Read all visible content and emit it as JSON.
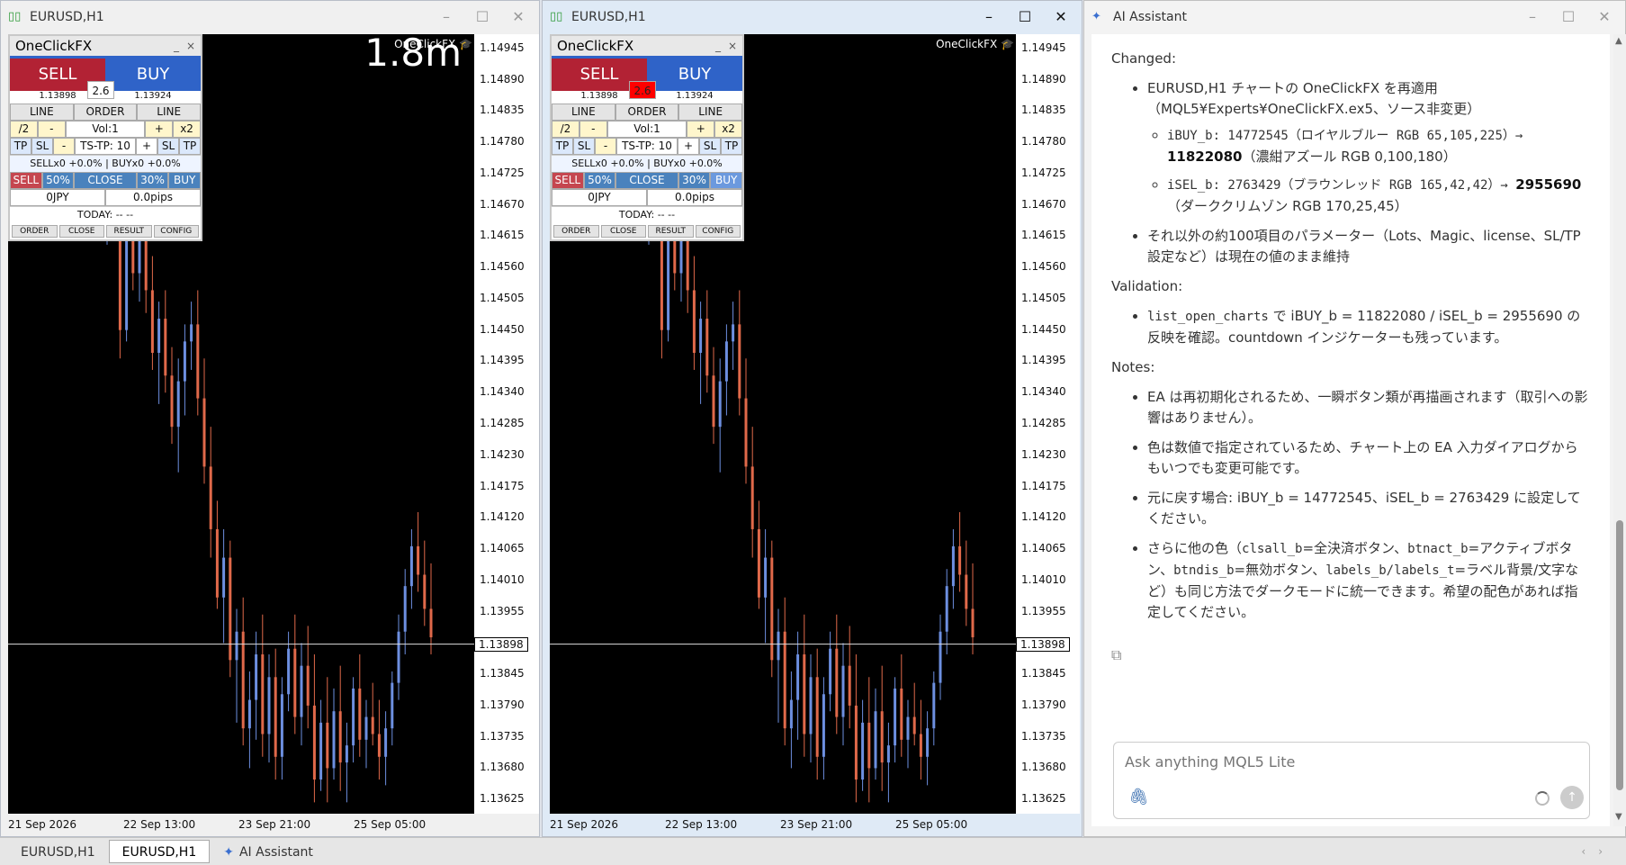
{
  "windows": [
    {
      "title": "EURUSD,H1",
      "countdown": "1.8m",
      "spread_highlight": false,
      "close_pressed": false
    },
    {
      "title": "EURUSD,H1",
      "countdown": "",
      "spread_highlight": true,
      "close_pressed": true
    }
  ],
  "chart": {
    "ea_label": "OneClickFX",
    "current_price": "1.13898",
    "price_ticks": [
      "1.14945",
      "1.14890",
      "1.14835",
      "1.14780",
      "1.14725",
      "1.14670",
      "1.14615",
      "1.14560",
      "1.14505",
      "1.14450",
      "1.14395",
      "1.14340",
      "1.14285",
      "1.14230",
      "1.14175",
      "1.14120",
      "1.14065",
      "1.14010",
      "1.13955",
      "1.13900",
      "1.13845",
      "1.13790",
      "1.13735",
      "1.13680",
      "1.13625"
    ],
    "time_ticks": [
      "21 Sep 2026",
      "22 Sep 13:00",
      "23 Sep 21:00",
      "25 Sep 05:00"
    ],
    "ylim": [
      1.136,
      1.1497
    ],
    "bull_color": "#6d8fe0",
    "bear_color": "#e0694a",
    "candles": [
      [
        1.1466,
        1.1491,
        1.146,
        1.1486
      ],
      [
        1.1486,
        1.1492,
        1.1468,
        1.1472
      ],
      [
        1.1472,
        1.148,
        1.144,
        1.1445
      ],
      [
        1.1445,
        1.1468,
        1.1443,
        1.1465
      ],
      [
        1.1465,
        1.1476,
        1.1452,
        1.1455
      ],
      [
        1.1455,
        1.147,
        1.145,
        1.1466
      ],
      [
        1.1466,
        1.1474,
        1.1448,
        1.1452
      ],
      [
        1.1452,
        1.1458,
        1.1438,
        1.1441
      ],
      [
        1.1441,
        1.145,
        1.1432,
        1.1447
      ],
      [
        1.1447,
        1.1452,
        1.1434,
        1.1437
      ],
      [
        1.1437,
        1.1442,
        1.1425,
        1.1428
      ],
      [
        1.1428,
        1.144,
        1.142,
        1.1436
      ],
      [
        1.1436,
        1.1446,
        1.143,
        1.1443
      ],
      [
        1.1443,
        1.145,
        1.1438,
        1.1446
      ],
      [
        1.1446,
        1.1452,
        1.143,
        1.1433
      ],
      [
        1.1433,
        1.144,
        1.1418,
        1.1421
      ],
      [
        1.1421,
        1.1428,
        1.1405,
        1.141
      ],
      [
        1.141,
        1.1415,
        1.1396,
        1.1398
      ],
      [
        1.1398,
        1.141,
        1.139,
        1.1405
      ],
      [
        1.1405,
        1.1408,
        1.1384,
        1.1387
      ],
      [
        1.1387,
        1.1396,
        1.1376,
        1.1392
      ],
      [
        1.1392,
        1.1398,
        1.1372,
        1.1375
      ],
      [
        1.1375,
        1.1385,
        1.1368,
        1.138
      ],
      [
        1.138,
        1.1392,
        1.1373,
        1.1388
      ],
      [
        1.1388,
        1.1395,
        1.137,
        1.1374
      ],
      [
        1.1374,
        1.1388,
        1.1369,
        1.1384
      ],
      [
        1.1384,
        1.1389,
        1.1366,
        1.137
      ],
      [
        1.137,
        1.1384,
        1.1366,
        1.1381
      ],
      [
        1.1381,
        1.1392,
        1.1378,
        1.1389
      ],
      [
        1.1389,
        1.1395,
        1.1374,
        1.1377
      ],
      [
        1.1377,
        1.139,
        1.1372,
        1.1386
      ],
      [
        1.1386,
        1.1393,
        1.1375,
        1.1379
      ],
      [
        1.1379,
        1.1388,
        1.1362,
        1.1366
      ],
      [
        1.1366,
        1.138,
        1.1364,
        1.1376
      ],
      [
        1.1376,
        1.1384,
        1.1362,
        1.1368
      ],
      [
        1.1368,
        1.1382,
        1.1366,
        1.1378
      ],
      [
        1.1378,
        1.1386,
        1.1364,
        1.1369
      ],
      [
        1.1369,
        1.1376,
        1.1362,
        1.1372
      ],
      [
        1.1372,
        1.1384,
        1.1369,
        1.1382
      ],
      [
        1.1382,
        1.1388,
        1.137,
        1.1373
      ],
      [
        1.1373,
        1.138,
        1.1368,
        1.1377
      ],
      [
        1.1377,
        1.1383,
        1.1372,
        1.1374
      ],
      [
        1.1374,
        1.138,
        1.1366,
        1.137
      ],
      [
        1.137,
        1.1378,
        1.1365,
        1.1375
      ],
      [
        1.1375,
        1.1385,
        1.1372,
        1.1383
      ],
      [
        1.1383,
        1.1395,
        1.138,
        1.1392
      ],
      [
        1.1392,
        1.1403,
        1.1388,
        1.14
      ],
      [
        1.14,
        1.141,
        1.1396,
        1.1407
      ],
      [
        1.1407,
        1.1413,
        1.1399,
        1.1402
      ],
      [
        1.1402,
        1.1408,
        1.1393,
        1.1396
      ],
      [
        1.1396,
        1.1404,
        1.1388,
        1.1391
      ]
    ]
  },
  "ocfx": {
    "title": "OneClickFX",
    "min": "_",
    "close": "×",
    "sell": "SELL",
    "buy": "BUY",
    "spread": "2.6",
    "bid": "1.13898",
    "ask": "1.13924",
    "row1": [
      "LINE",
      "ORDER",
      "LINE"
    ],
    "row2": [
      "/2",
      "-",
      "Vol:1",
      "+",
      "x2"
    ],
    "row3": [
      "TP",
      "SL",
      "-",
      "TS-TP: 10",
      "+",
      "SL",
      "TP"
    ],
    "positions": "SELLx0 +0.0%  |  BUYx0 +0.0%",
    "row4": [
      "SELL",
      "50%",
      "CLOSE",
      "30%",
      "BUY"
    ],
    "row5": [
      "0JPY",
      "0.0pips"
    ],
    "today": "TODAY: -- --",
    "bottom": [
      "ORDER",
      "CLOSE",
      "RESULT",
      "CONFIG"
    ]
  },
  "ai": {
    "title": "AI Assistant",
    "changed_heading": "Changed:",
    "change1_line": "EURUSD,H1 チャートの OneClickFX を再適用（MQL5¥Experts¥OneClickFX.ex5、ソース非変更）",
    "ibuy_a": "iBUY_b: 14772545（ロイヤルブルー RGB 65,105,225）→ ",
    "ibuy_b": "11822080",
    "ibuy_c": "（濃紺アズール RGB 0,100,180）",
    "isel_a": "iSEL_b: 2763429（ブラウンレッド RGB 165,42,42）→ ",
    "isel_b": "2955690",
    "isel_c": "（ダーククリムゾン RGB 170,25,45）",
    "change2": "それ以外の約100項目のパラメーター（Lots、Magic、license、SL/TP設定など）は現在の値のまま維持",
    "validation_heading": "Validation:",
    "val_code": "list_open_charts",
    "val_rest": " で iBUY_b = 11822080 / iSEL_b = 2955690 の反映を確認。countdown インジケーターも残っています。",
    "notes_heading": "Notes:",
    "note1": "EA は再初期化されるため、一瞬ボタン類が再描画されます（取引への影響はありません）。",
    "note2": "色は数値で指定されているため、チャート上の EA 入力ダイアログからもいつでも変更可能です。",
    "note3": "元に戻す場合: iBUY_b = 14772545、iSEL_b = 2763429 に設定してください。",
    "note4_a": "さらに他の色（",
    "note4_c1": "clsall_b",
    "note4_b": "=全決済ボタン、",
    "note4_c2": "btnact_b",
    "note4_d": "=アクティブボタン、",
    "note4_c3": "btndis_b",
    "note4_e": "=無効ボタン、",
    "note4_c4": "labels_b/labels_t",
    "note4_f": "=ラベル背景/文字など）も同じ方法でダークモードに統一できます。希望の配色があれば指定してください。",
    "input_placeholder": "Ask anything MQL5 Lite"
  },
  "tabs": [
    "EURUSD,H1",
    "EURUSD,H1",
    "AI Assistant"
  ]
}
